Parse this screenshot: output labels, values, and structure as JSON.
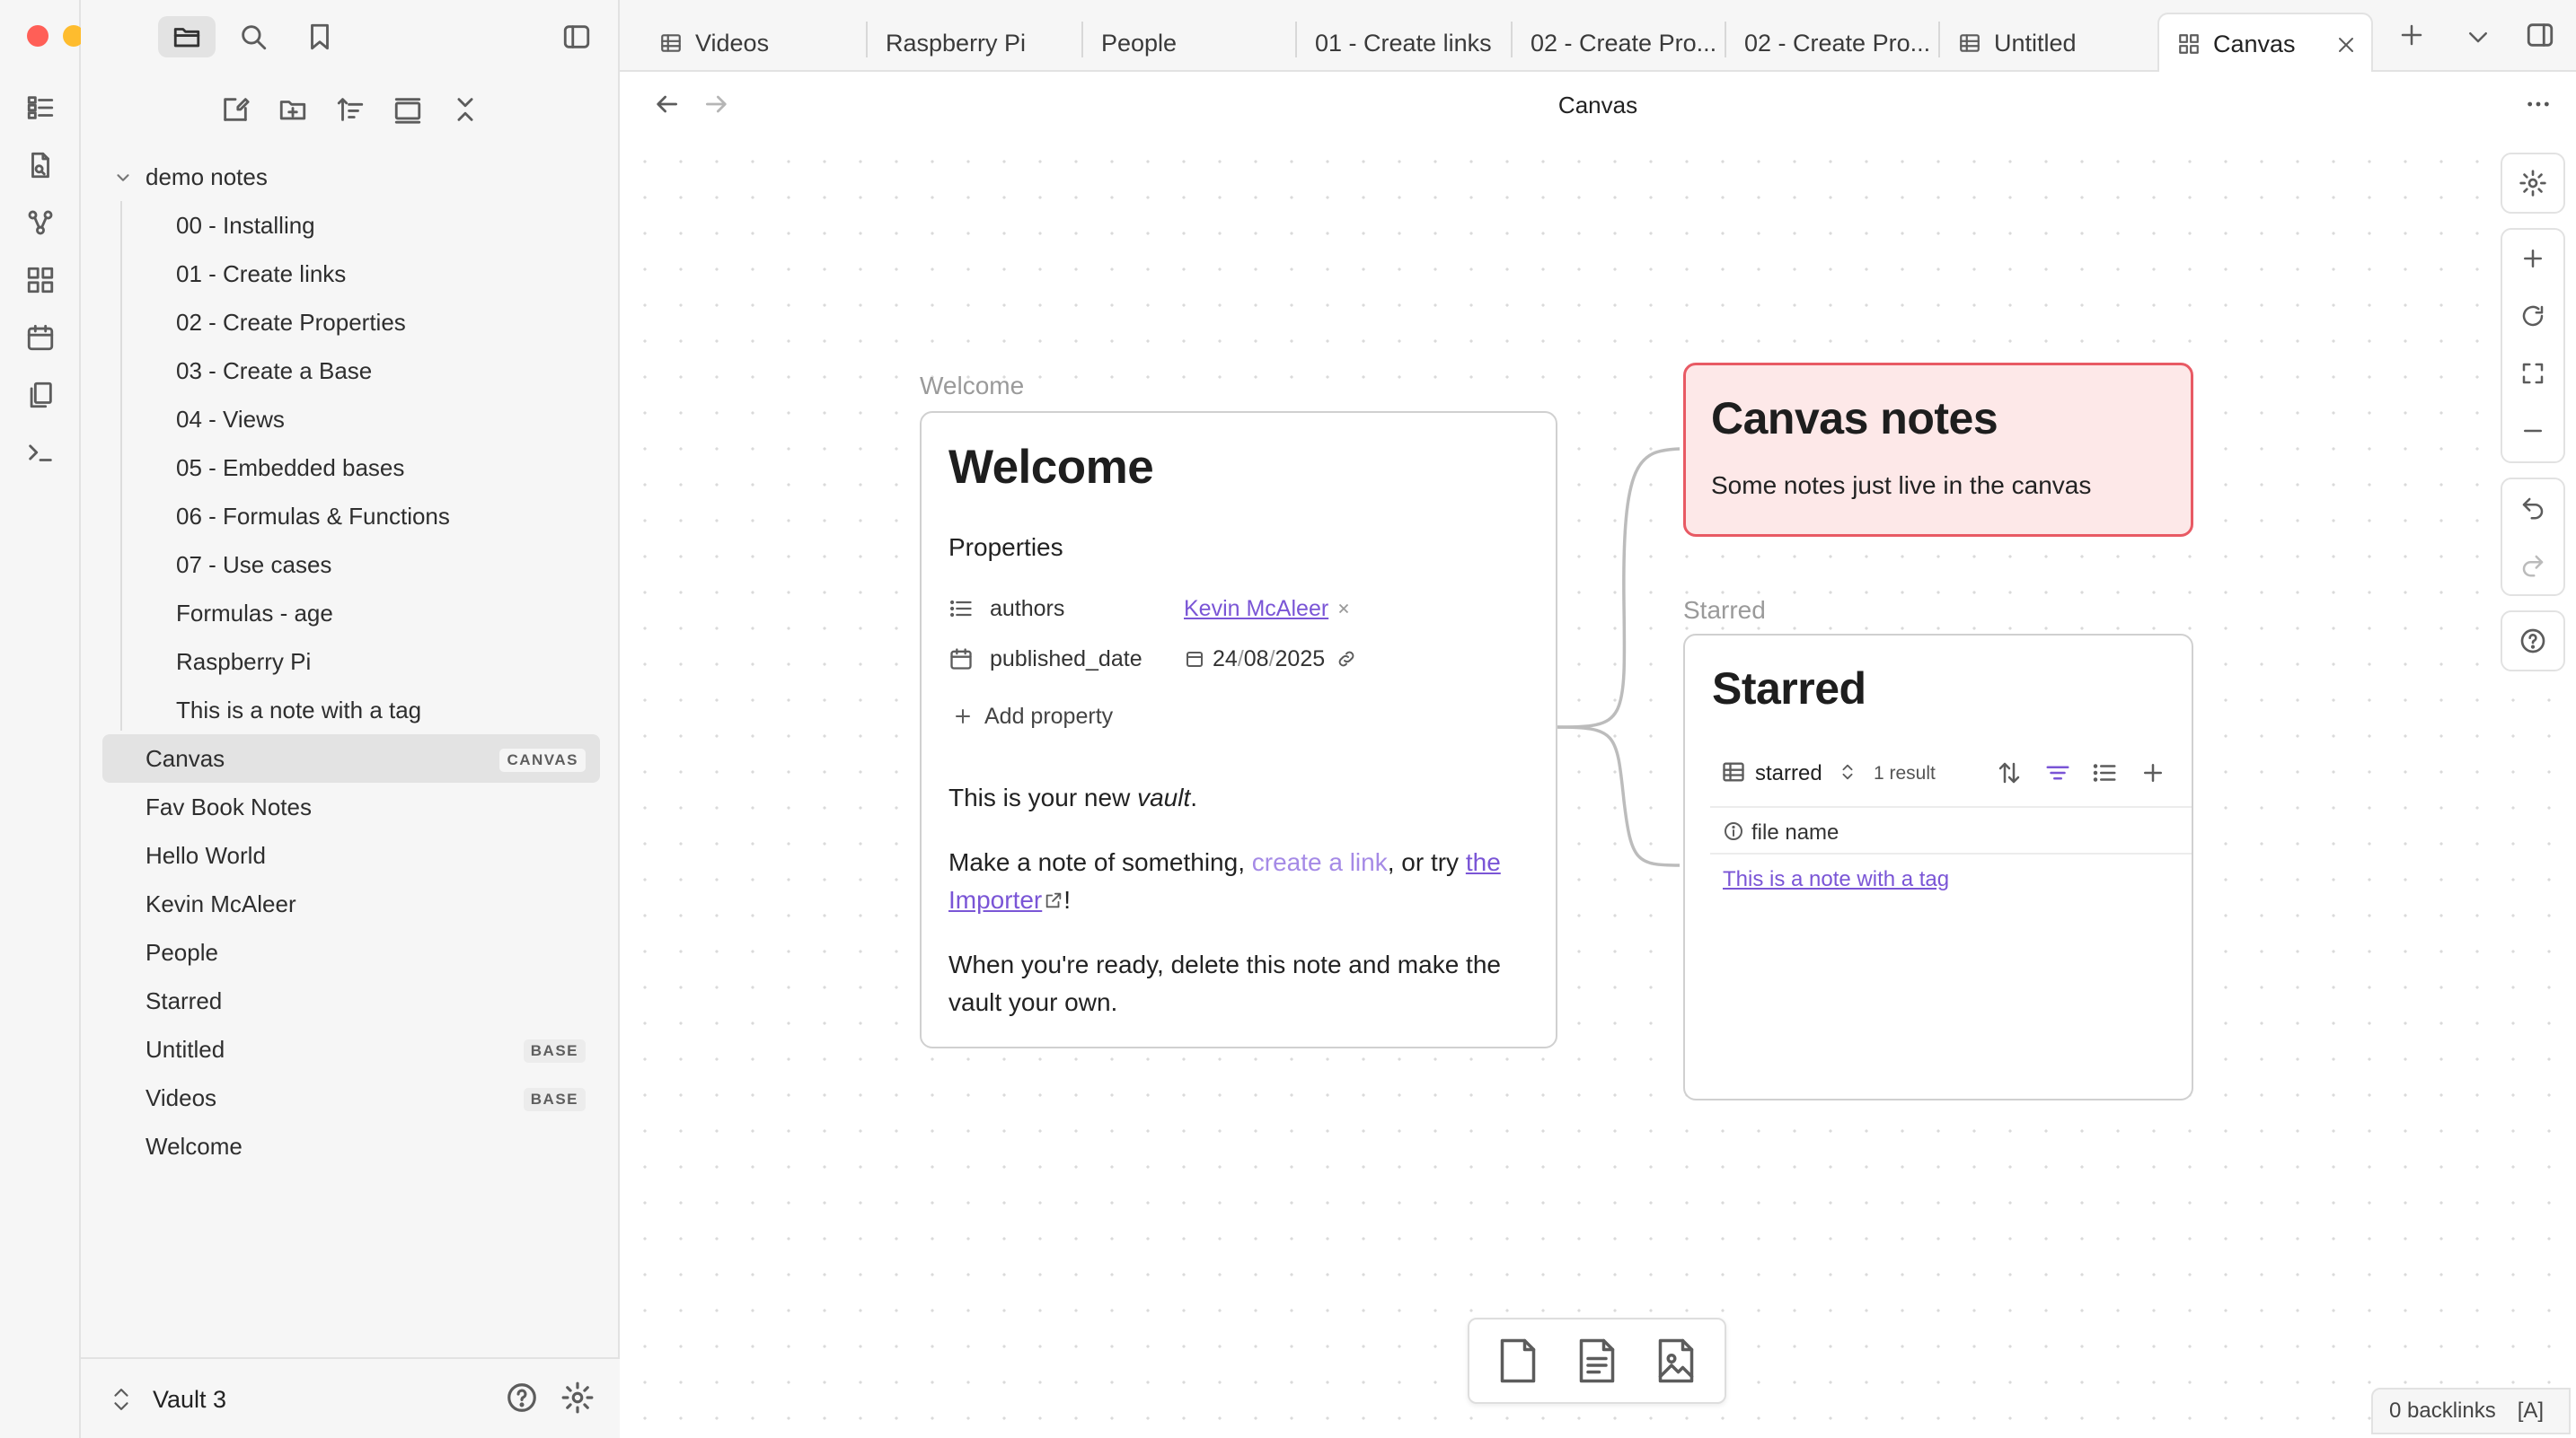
{
  "window": {
    "traffic_lights": {
      "close": "#ff5f57",
      "minimize": "#febc2e",
      "zoom": "#28c840"
    }
  },
  "ribbon": {
    "icons": [
      "dashboard-icon",
      "new-file-icon",
      "graph-icon",
      "grid-icon",
      "calendar-icon",
      "copy-icon",
      "terminal-icon"
    ]
  },
  "sidebar": {
    "tree": {
      "folder": "demo notes",
      "children": [
        "00 - Installing",
        "01 - Create links",
        "02 - Create Properties",
        "03 - Create a Base",
        "04 - Views",
        "05 - Embedded bases",
        "06 - Formulas & Functions",
        "07 - Use cases",
        "Formulas - age",
        "Raspberry Pi",
        "This is a note with a tag"
      ],
      "root_items": [
        {
          "label": "Canvas",
          "badge": "CANVAS"
        },
        {
          "label": "Fav Book Notes",
          "badge": ""
        },
        {
          "label": "Hello World",
          "badge": ""
        },
        {
          "label": "Kevin McAleer",
          "badge": ""
        },
        {
          "label": "People",
          "badge": ""
        },
        {
          "label": "Starred",
          "badge": ""
        },
        {
          "label": "Untitled",
          "badge": "BASE"
        },
        {
          "label": "Videos",
          "badge": "BASE"
        },
        {
          "label": "Welcome",
          "badge": ""
        }
      ]
    },
    "footer": {
      "vault_name": "Vault 3"
    }
  },
  "tabs": [
    {
      "label": "Videos",
      "icon": "table-icon"
    },
    {
      "label": "Raspberry Pi",
      "icon": ""
    },
    {
      "label": "People",
      "icon": ""
    },
    {
      "label": "01 - Create links",
      "icon": ""
    },
    {
      "label": "02 - Create Pro...",
      "icon": ""
    },
    {
      "label": "02 - Create Pro...",
      "icon": ""
    },
    {
      "label": "Untitled",
      "icon": "table-icon"
    },
    {
      "label": "Canvas",
      "icon": "canvas-icon",
      "active": true
    }
  ],
  "view": {
    "title": "Canvas"
  },
  "canvas": {
    "welcome": {
      "label": "Welcome",
      "heading": "Welcome",
      "properties_title": "Properties",
      "properties": [
        {
          "name": "authors",
          "value": "Kevin McAleer"
        },
        {
          "name": "published_date",
          "value_day": "24",
          "value_month": "08",
          "value_year": "2025"
        }
      ],
      "add_property": "Add property",
      "p1_a": "This is your new ",
      "p1_b": "vault",
      "p1_c": ".",
      "p2_a": "Make a note of something, ",
      "p2_link": "create a link",
      "p2_b": ", or try ",
      "p2_link2_a": "the",
      "p2_link2_b": "Importer",
      "p2_c": "!",
      "p3_a": "When you're ready, delete this note and make the",
      "p3_b": "vault your own."
    },
    "notes": {
      "heading": "Canvas notes",
      "body": "Some notes just live in the canvas",
      "border_color": "#e85a64",
      "fill_color": "#fde8e8"
    },
    "starred": {
      "label": "Starred",
      "heading": "Starred",
      "view_name": "starred",
      "result_count": "1 result",
      "column": "file name",
      "row": "This is a note with a tag"
    }
  },
  "status": {
    "backlinks": "0 backlinks",
    "mode": "[A]"
  },
  "accent": "#7a55d6"
}
